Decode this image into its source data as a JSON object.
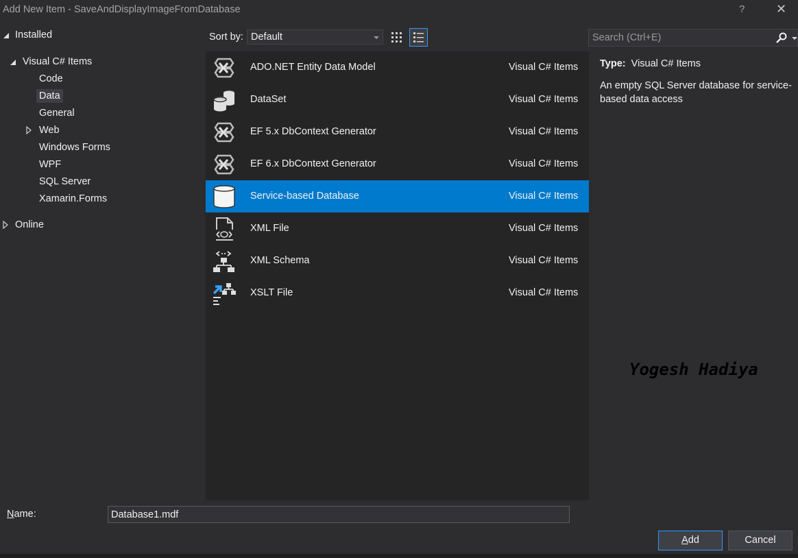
{
  "window": {
    "title": "Add New Item - SaveAndDisplayImageFromDatabase",
    "help": "?",
    "close": "✕"
  },
  "tree": {
    "installed": "Installed",
    "visual_csharp": "Visual C# Items",
    "children": [
      "Code",
      "Data",
      "General",
      "Web",
      "Windows Forms",
      "WPF",
      "SQL Server",
      "Xamarin.Forms"
    ],
    "selected": "Data",
    "online": "Online"
  },
  "toolbar": {
    "sort_label": "Sort by:",
    "sort_value": "Default",
    "search_placeholder": "Search (Ctrl+E)"
  },
  "items": [
    {
      "name": "ADO.NET Entity Data Model",
      "category": "Visual C# Items",
      "icon": "entity-model-icon"
    },
    {
      "name": "DataSet",
      "category": "Visual C# Items",
      "icon": "dataset-icon"
    },
    {
      "name": "EF 5.x DbContext Generator",
      "category": "Visual C# Items",
      "icon": "entity-model-icon"
    },
    {
      "name": "EF 6.x DbContext Generator",
      "category": "Visual C# Items",
      "icon": "entity-model-icon"
    },
    {
      "name": "Service-based Database",
      "category": "Visual C# Items",
      "icon": "database-icon",
      "selected": true
    },
    {
      "name": "XML File",
      "category": "Visual C# Items",
      "icon": "xml-file-icon"
    },
    {
      "name": "XML Schema",
      "category": "Visual C# Items",
      "icon": "xml-schema-icon"
    },
    {
      "name": "XSLT File",
      "category": "Visual C# Items",
      "icon": "xslt-file-icon"
    }
  ],
  "details": {
    "type_label": "Type:",
    "type_value": "Visual C# Items",
    "description": "An empty SQL Server database for service-based data access"
  },
  "watermark": "Yogesh Hadiya",
  "footer": {
    "name_label_underlined": "N",
    "name_label_rest": "ame:",
    "name_value": "Database1.mdf",
    "add_underlined": "A",
    "add_rest": "dd",
    "cancel": "Cancel"
  },
  "colors": {
    "background": "#2d2d30",
    "list_background": "#252526",
    "selection": "#007acc",
    "accent": "#3399ff"
  }
}
